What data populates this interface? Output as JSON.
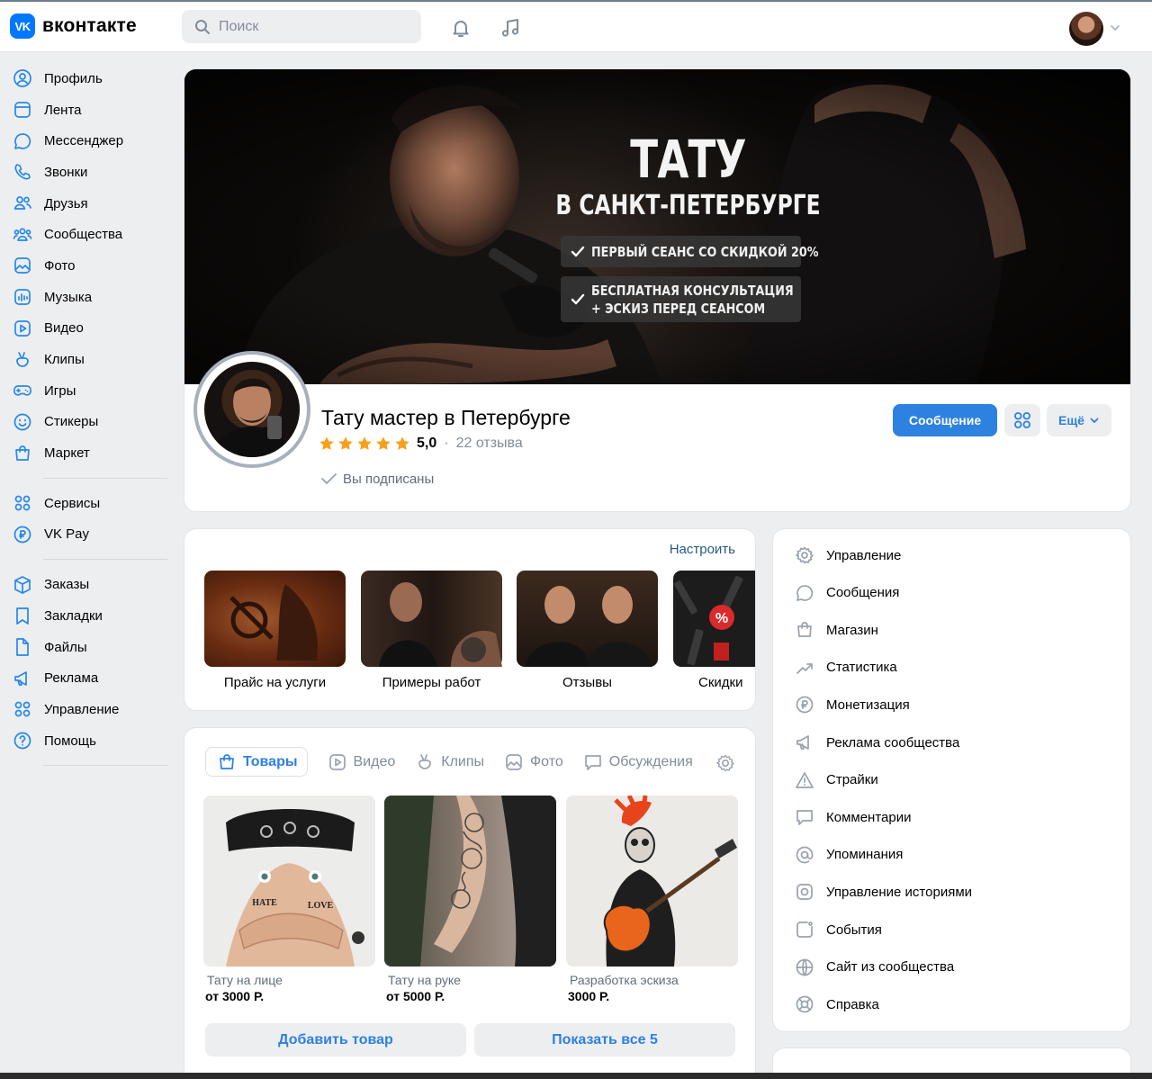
{
  "header": {
    "logo_mark": "VK",
    "logo_text": "вконтакте",
    "search_placeholder": "Поиск"
  },
  "sidebar": {
    "groups": [
      [
        {
          "label": "Профиль",
          "icon": "profile-icon"
        },
        {
          "label": "Лента",
          "icon": "feed-icon"
        },
        {
          "label": "Мессенджер",
          "icon": "messenger-icon"
        },
        {
          "label": "Звонки",
          "icon": "phone-icon"
        },
        {
          "label": "Друзья",
          "icon": "friends-icon"
        },
        {
          "label": "Сообщества",
          "icon": "communities-icon"
        },
        {
          "label": "Фото",
          "icon": "photo-icon"
        },
        {
          "label": "Музыка",
          "icon": "music-icon"
        },
        {
          "label": "Видео",
          "icon": "video-icon"
        },
        {
          "label": "Клипы",
          "icon": "clips-icon"
        },
        {
          "label": "Игры",
          "icon": "games-icon"
        },
        {
          "label": "Стикеры",
          "icon": "stickers-icon"
        },
        {
          "label": "Маркет",
          "icon": "market-icon"
        }
      ],
      [
        {
          "label": "Сервисы",
          "icon": "services-icon"
        },
        {
          "label": "VK Pay",
          "icon": "vkpay-icon"
        }
      ],
      [
        {
          "label": "Заказы",
          "icon": "orders-icon"
        },
        {
          "label": "Закладки",
          "icon": "bookmarks-icon"
        },
        {
          "label": "Файлы",
          "icon": "files-icon"
        },
        {
          "label": "Реклама",
          "icon": "ads-icon"
        },
        {
          "label": "Управление",
          "icon": "manage-icon"
        },
        {
          "label": "Помощь",
          "icon": "help-icon"
        }
      ]
    ]
  },
  "cover": {
    "title": "ТАТУ",
    "subtitle": "В САНКТ-ПЕТЕРБУРГЕ",
    "badge1": "ПЕРВЫЙ СЕАНС СО СКИДКОЙ 20%",
    "badge2_line1": "БЕСПЛАТНАЯ КОНСУЛЬТАЦИЯ",
    "badge2_line2": "+ ЭСКИЗ ПЕРЕД СЕАНСОМ"
  },
  "profile": {
    "name": "Тату мастер в Петербурге",
    "stars": 5,
    "score": "5,0",
    "separator": "·",
    "reviews": "22 отзыва",
    "subscribed": "Вы подписаны",
    "message_button": "Сообщение",
    "more_button": "Ещё"
  },
  "highlights": {
    "configure": "Настроить",
    "items": [
      {
        "label": "Прайс на услуги"
      },
      {
        "label": "Примеры работ"
      },
      {
        "label": "Отзывы"
      },
      {
        "label": "Скидки"
      }
    ],
    "discount_mark": "%"
  },
  "tabs": [
    {
      "label": "Товары",
      "icon": "bag-icon",
      "active": true
    },
    {
      "label": "Видео",
      "icon": "video-icon",
      "active": false
    },
    {
      "label": "Клипы",
      "icon": "clips-icon",
      "active": false
    },
    {
      "label": "Фото",
      "icon": "photo-icon",
      "active": false
    },
    {
      "label": "Обсуждения",
      "icon": "discussion-icon",
      "active": false
    }
  ],
  "products": [
    {
      "name": "Тату на лице",
      "price": "от 3000 Р."
    },
    {
      "name": "Тату на руке",
      "price": "от 5000 Р."
    },
    {
      "name": "Разработка эскиза",
      "price": "3000 Р."
    }
  ],
  "product_image_text": {
    "hate": "HATE",
    "love": "LOVE"
  },
  "product_buttons": {
    "add": "Добавить товар",
    "show_all": "Показать все 5"
  },
  "admin_menu": [
    {
      "label": "Управление",
      "icon": "gear-icon"
    },
    {
      "label": "Сообщения",
      "icon": "message-icon"
    },
    {
      "label": "Магазин",
      "icon": "shop-icon"
    },
    {
      "label": "Статистика",
      "icon": "stats-icon"
    },
    {
      "label": "Монетизация",
      "icon": "ruble-icon"
    },
    {
      "label": "Реклама сообщества",
      "icon": "megaphone-icon"
    },
    {
      "label": "Страйки",
      "icon": "warning-icon"
    },
    {
      "label": "Комментарии",
      "icon": "comment-icon"
    },
    {
      "label": "Упоминания",
      "icon": "at-icon"
    },
    {
      "label": "Управление историями",
      "icon": "stories-icon"
    },
    {
      "label": "События",
      "icon": "events-icon"
    },
    {
      "label": "Сайт из сообщества",
      "icon": "globe-icon"
    },
    {
      "label": "Справка",
      "icon": "lifebuoy-icon"
    }
  ],
  "colors": {
    "accent": "#2d81e0",
    "link": "#2a5885",
    "star": "#f8a01c",
    "icon_blue": "#2688eb",
    "bg": "#edeef0"
  }
}
